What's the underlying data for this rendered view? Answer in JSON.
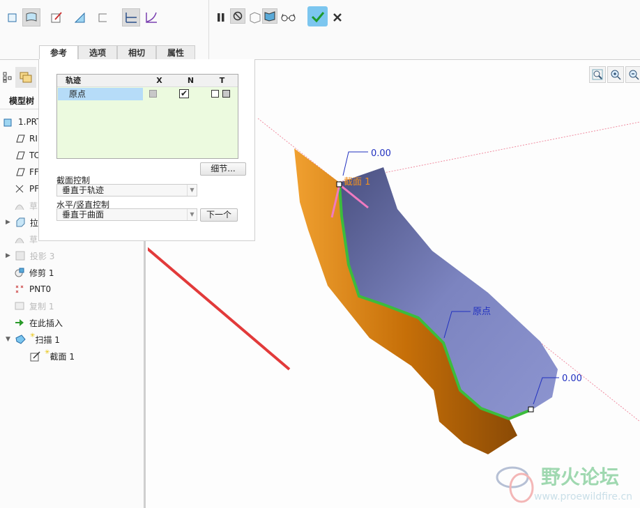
{
  "ribbon": {
    "tabs": [
      "参考",
      "选项",
      "相切",
      "属性"
    ],
    "active_tab": "参考"
  },
  "tree": {
    "header": "模型树",
    "items": [
      {
        "label": "1.PRT",
        "icon": "part-icon"
      },
      {
        "label": "RI",
        "icon": "datum-plane-icon"
      },
      {
        "label": "TC",
        "icon": "datum-plane-icon"
      },
      {
        "label": "FF",
        "icon": "datum-plane-icon"
      },
      {
        "label": "PF",
        "icon": "csys-icon"
      },
      {
        "label": "草",
        "icon": "sketch-icon",
        "dim": true
      },
      {
        "label": "拉",
        "icon": "extrude-icon",
        "expand": true
      },
      {
        "label": "草",
        "icon": "sketch-icon",
        "dim": true
      },
      {
        "label": "投影 3",
        "icon": "projection-icon",
        "dim": true,
        "expand": true
      },
      {
        "label": "修剪 1",
        "icon": "trim-icon"
      },
      {
        "label": "PNT0",
        "icon": "datum-point-icon"
      },
      {
        "label": "复制 1",
        "icon": "copy-icon",
        "dim": true
      },
      {
        "label": "在此插入",
        "icon": "insert-here-arrow-icon"
      },
      {
        "label": "扫描 1",
        "icon": "sweep-icon",
        "expand": true,
        "open": true
      },
      {
        "label": "截面 1",
        "icon": "sketch-section-icon"
      }
    ]
  },
  "panel": {
    "table": {
      "headers": [
        "轨迹",
        "X",
        "N",
        "T"
      ],
      "rows": [
        {
          "name": "原点",
          "x": false,
          "n": true,
          "t": false
        }
      ]
    },
    "details_button": "细节...",
    "section_plane_label": "截面控制",
    "section_plane_value": "垂直于轨迹",
    "hv_label": "水平/竖直控制",
    "hv_value": "垂直于曲面",
    "next_button": "下一个"
  },
  "viewport": {
    "dim_top": "0.00",
    "dim_bottom": "0.00",
    "section_label": "截面 1",
    "origin_label": "原点",
    "watermark_title": "野火论坛",
    "watermark_url": "www.proewildfire.cn"
  },
  "colors": {
    "accent": "#3a9ad9",
    "orange": "#d9800f",
    "surface": "#7d86c4",
    "curve": "#3cbc3c",
    "arrow": "#e23a3a"
  }
}
